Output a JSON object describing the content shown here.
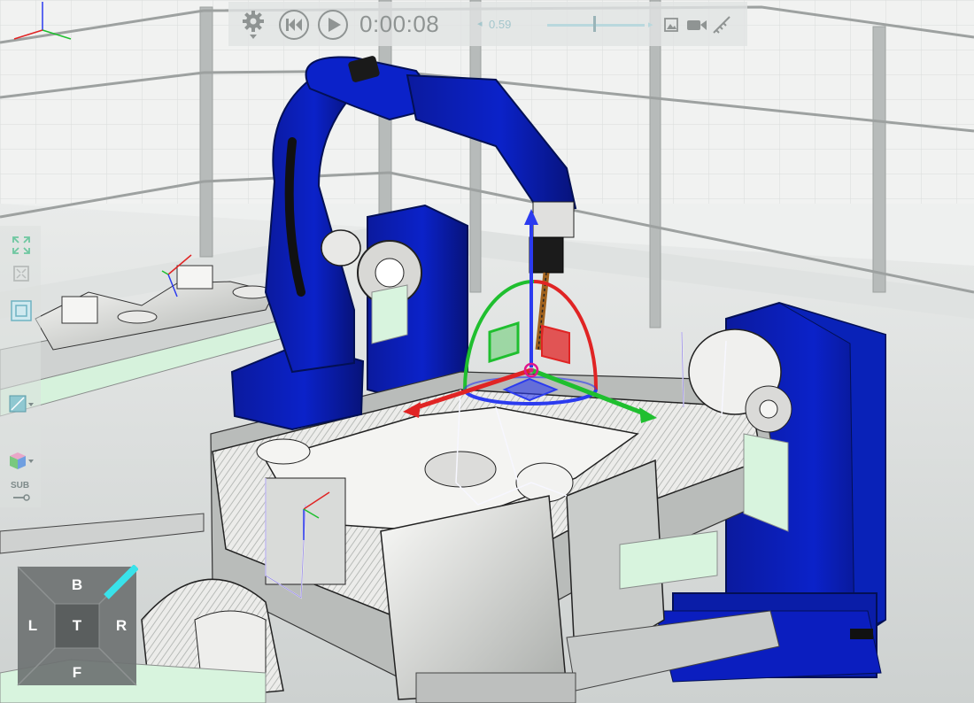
{
  "playback": {
    "time": "0:00:08",
    "speed": "0.59"
  },
  "icons": {
    "settings": "gear-icon",
    "rewind": "skip-to-start-icon",
    "play": "play-icon",
    "speed_decrease": "chevron-left-icon",
    "speed_increase": "chevron-right-icon",
    "snapshot": "image-snapshot-icon",
    "record": "video-camera-icon",
    "measure": "measure-icon",
    "fit_all": "expand-arrows-icon",
    "fit_selected": "fit-selection-icon",
    "section": "section-view-icon",
    "view_orientation": "view-orientation-icon",
    "display_mode": "cube-display-icon",
    "sub_tool": "sub-tool-icon"
  },
  "left_tools": {
    "sub_label": "SUB"
  },
  "view_cube": {
    "back": "B",
    "left": "L",
    "top": "T",
    "right": "R",
    "front": "F"
  },
  "colors": {
    "robot_blue": "#0a1fb8",
    "robot_blue_dark": "#061270",
    "highlight_cyan": "#39e2ea",
    "gizmo_red": "#e02424",
    "gizmo_green": "#1fbf2f",
    "gizmo_blue": "#2b3bef",
    "workpiece_light": "#f0f0ec",
    "background": "#e9ebea"
  }
}
